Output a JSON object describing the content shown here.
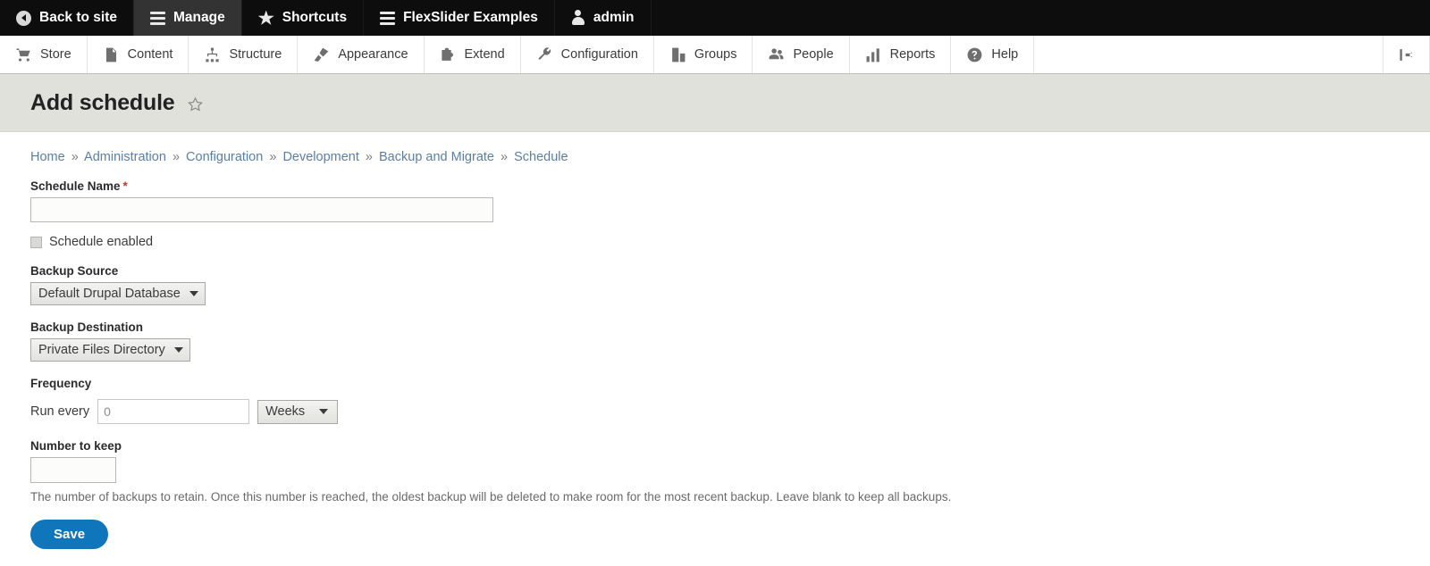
{
  "toolbar_top": {
    "items": [
      {
        "label": "Back to site",
        "icon": "back-circle-icon",
        "active": false
      },
      {
        "label": "Manage",
        "icon": "hamburger-icon",
        "active": true
      },
      {
        "label": "Shortcuts",
        "icon": "star-icon",
        "active": false
      },
      {
        "label": "FlexSlider Examples",
        "icon": "hamburger-icon",
        "active": false
      },
      {
        "label": "admin",
        "icon": "person-icon",
        "active": false
      }
    ]
  },
  "admin_menu": {
    "items": [
      {
        "label": "Store",
        "icon": "shopping-cart-icon"
      },
      {
        "label": "Content",
        "icon": "document-icon"
      },
      {
        "label": "Structure",
        "icon": "sitemap-icon"
      },
      {
        "label": "Appearance",
        "icon": "paintbrush-icon"
      },
      {
        "label": "Extend",
        "icon": "puzzle-piece-icon"
      },
      {
        "label": "Configuration",
        "icon": "wrench-icon"
      },
      {
        "label": "Groups",
        "icon": "lock-building-icon"
      },
      {
        "label": "People",
        "icon": "people-icon"
      },
      {
        "label": "Reports",
        "icon": "bar-chart-icon"
      },
      {
        "label": "Help",
        "icon": "question-circle-icon"
      }
    ],
    "orientation_toggle_icon": "vertical-orientation-icon"
  },
  "page": {
    "title": "Add schedule",
    "bookmark_icon": "star-outline-icon"
  },
  "breadcrumb": {
    "separator": "»",
    "items": [
      "Home",
      "Administration",
      "Configuration",
      "Development",
      "Backup and Migrate",
      "Schedule"
    ]
  },
  "form": {
    "schedule_name": {
      "label": "Schedule Name",
      "required_marker": "*",
      "value": "",
      "placeholder": ""
    },
    "schedule_enabled": {
      "label": "Schedule enabled",
      "checked": false
    },
    "backup_source": {
      "label": "Backup Source",
      "selected": "Default Drupal Database"
    },
    "backup_destination": {
      "label": "Backup Destination",
      "selected": "Private Files Directory"
    },
    "frequency": {
      "label": "Frequency",
      "run_every_label": "Run every",
      "run_every_value": "",
      "run_every_placeholder": "0",
      "period_selected": "Weeks"
    },
    "number_to_keep": {
      "label": "Number to keep",
      "value": "",
      "placeholder": "",
      "description": "The number of backups to retain. Once this number is reached, the oldest backup will be deleted to make room for the most recent backup. Leave blank to keep all backups."
    },
    "save_button": "Save"
  },
  "colors": {
    "toolbar_black": "#0d0d0d",
    "toolbar_active": "#333333",
    "page_band": "#e1e1db",
    "link_blue": "#5a7fa6",
    "button_blue": "#1076bb",
    "required_red": "#c0392b"
  }
}
